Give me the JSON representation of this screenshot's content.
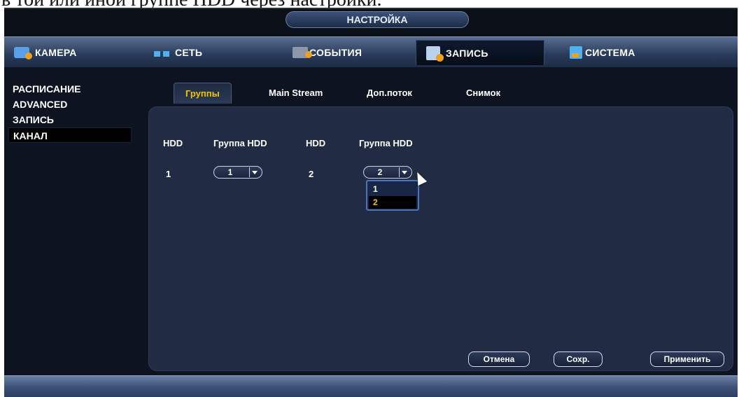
{
  "doc_caption": "в той или иной группе HDD через настройки.",
  "window": {
    "title": "НАСТРОЙКА"
  },
  "main_tabs": [
    {
      "label": "КАМЕРА",
      "icon": "camera-icon",
      "active": false
    },
    {
      "label": "СЕТЬ",
      "icon": "network-icon",
      "active": false
    },
    {
      "label": "СОБЫТИЯ",
      "icon": "events-icon",
      "active": false
    },
    {
      "label": "ЗАПИСЬ",
      "icon": "record-icon",
      "active": true
    },
    {
      "label": "СИСТЕМА",
      "icon": "system-icon",
      "active": false
    }
  ],
  "sidebar": {
    "items": [
      {
        "label": "РАСПИСАНИЕ",
        "active": false
      },
      {
        "label": "ADVANCED",
        "active": false
      },
      {
        "label": "ЗАПИСЬ",
        "active": false
      },
      {
        "label": "КАНАЛ",
        "active": true
      }
    ]
  },
  "sub_tabs": [
    {
      "label": "Группы",
      "active": true
    },
    {
      "label": "Main Stream",
      "active": false
    },
    {
      "label": "Доп.поток",
      "active": false
    },
    {
      "label": "Снимок",
      "active": false
    }
  ],
  "table": {
    "headers": [
      "HDD",
      "Группа HDD",
      "HDD",
      "Группа HDD"
    ],
    "rows": [
      {
        "hdd_a": "1",
        "group_a": "1",
        "hdd_b": "2",
        "group_b": "2"
      }
    ]
  },
  "dropdown": {
    "options": [
      "1",
      "2"
    ],
    "selected": "2"
  },
  "buttons": {
    "cancel": "Отмена",
    "save": "Сохр.",
    "apply": "Применить"
  },
  "colors": {
    "accent_yellow": "#f5c400",
    "panel_bg": "#212b44",
    "window_bg": "#0b0f18",
    "dropdown_border": "#4a73c0"
  }
}
